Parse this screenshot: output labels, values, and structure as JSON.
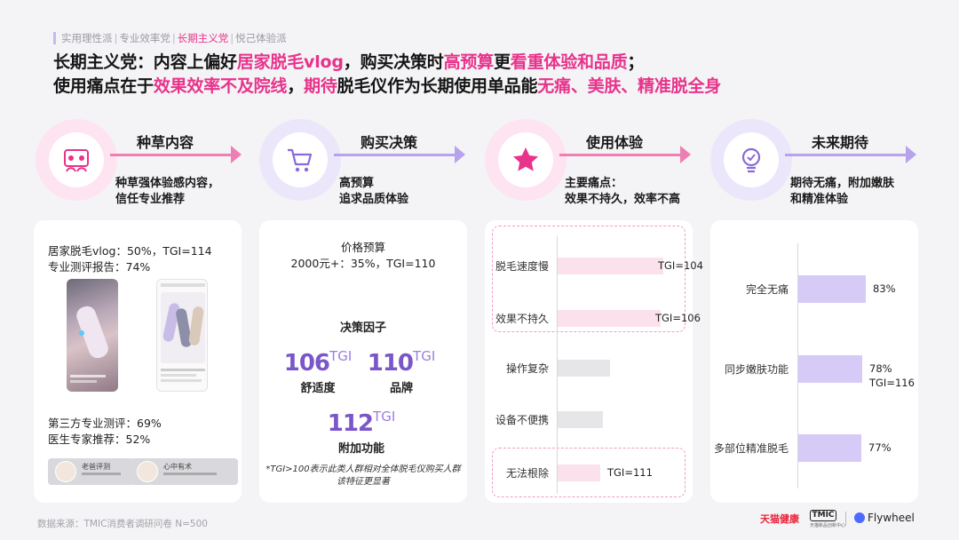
{
  "tabs": [
    {
      "label": "实用理性派",
      "active": false
    },
    {
      "label": "专业效率党",
      "active": false
    },
    {
      "label": "长期主义党",
      "active": true
    },
    {
      "label": "悦己体验派",
      "active": false
    }
  ],
  "tab_separator": "|",
  "headline": {
    "line1": [
      {
        "t": "长期主义党：内容上偏好",
        "hl": false
      },
      {
        "t": "居家脱毛vlog",
        "hl": true
      },
      {
        "t": "，购买决策时",
        "hl": false
      },
      {
        "t": "高预算",
        "hl": true
      },
      {
        "t": "更",
        "hl": false
      },
      {
        "t": "看重体验和品质",
        "hl": true
      },
      {
        "t": "；",
        "hl": false
      }
    ],
    "line2": [
      {
        "t": "使用痛点在于",
        "hl": false
      },
      {
        "t": "效果效率不及院线",
        "hl": true
      },
      {
        "t": "，",
        "hl": false
      },
      {
        "t": "期待",
        "hl": true
      },
      {
        "t": "脱毛仪作为长期使用单品能",
        "hl": false
      },
      {
        "t": "无痛、美肤、精准脱全身",
        "hl": true
      }
    ]
  },
  "stages": [
    {
      "title": "种草内容",
      "desc": [
        "种草强体验感内容，",
        "信任专业推荐"
      ],
      "icon": "content-icon",
      "color": "#ee7fb5",
      "light": "#fde4f0"
    },
    {
      "title": "购买决策",
      "desc": [
        "高预算",
        "追求品质体验"
      ],
      "icon": "cart-icon",
      "color": "#b7a2ee",
      "light": "#ece6fb"
    },
    {
      "title": "使用体验",
      "desc": [
        "主要痛点：",
        "效果不持久，效率不高"
      ],
      "icon": "star-icon",
      "color": "#ee7fb5",
      "light": "#fde4f0"
    },
    {
      "title": "未来期待",
      "desc": [
        "期待无痛，附加嫩肤",
        "和精准体验"
      ],
      "icon": "bulb-icon",
      "color": "#b7a2ee",
      "light": "#ece6fb"
    }
  ],
  "card1": {
    "stats_top": [
      "居家脱毛vlog：50%，TGI=114",
      "专业测评报告：74%"
    ],
    "stats_bottom": [
      "第三方专业测评：69%",
      "医生专家推荐：52%"
    ],
    "mini_cards": [
      "老爸评测",
      "心中有术"
    ]
  },
  "card2": {
    "budget_label": "价格预算",
    "budget_value": "2000元+：35%，TGI=110",
    "factors_title": "决策因子",
    "factors": [
      {
        "value": "106",
        "sup": "TGI",
        "label": "舒适度"
      },
      {
        "value": "110",
        "sup": "TGI",
        "label": "品牌"
      },
      {
        "value": "112",
        "sup": "TGI",
        "label": "附加功能"
      }
    ],
    "note": [
      "*TGI>100表示此类人群相对全体脱毛仪购买人群",
      "该特征更显著"
    ]
  },
  "chart_data": [
    {
      "type": "bar",
      "orientation": "horizontal",
      "categories": [
        "脱毛速度慢",
        "效果不持久",
        "操作复杂",
        "设备不便携",
        "无法根除"
      ],
      "values": [
        null,
        null,
        null,
        null,
        null
      ],
      "data_labels": [
        "TGI=104",
        "TGI=106",
        "",
        "",
        "TGI=111"
      ],
      "bar_lengths": [
        0.79,
        0.77,
        0.39,
        0.34,
        0.32
      ],
      "highlighted": [
        true,
        true,
        false,
        false,
        true
      ],
      "colors": {
        "highlight": "#fbe1ec",
        "normal": "#e6e6e9"
      }
    },
    {
      "type": "bar",
      "orientation": "horizontal",
      "categories": [
        "完全无痛",
        "同步嫩肤功能",
        "多部位精准脱毛"
      ],
      "values": [
        83,
        78,
        77
      ],
      "unit": "%",
      "data_labels": [
        "83%",
        "78%",
        "77%"
      ],
      "extra_labels": [
        "",
        "TGI=116",
        ""
      ],
      "colors": {
        "bar": "#d6caf6"
      }
    }
  ],
  "footer": {
    "source": "数据来源：TMIC消费者调研问卷 N=500",
    "logo1": "天猫健康",
    "logo2": "TMIC",
    "logo2_sub": "天猫新品创新中心",
    "logo3": "Flywheel"
  }
}
